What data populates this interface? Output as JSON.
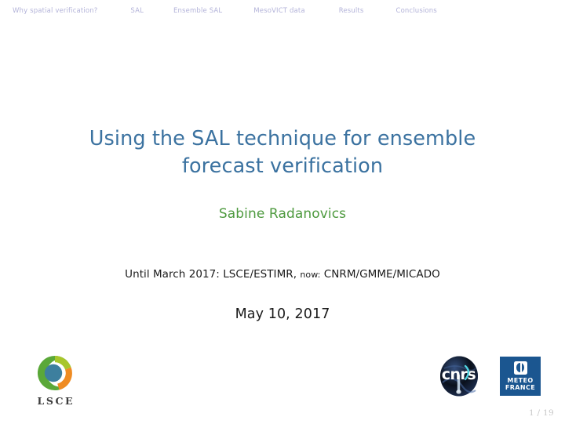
{
  "navigation": {
    "items": [
      {
        "label": "Why spatial verification?"
      },
      {
        "label": "SAL"
      },
      {
        "label": "Ensemble SAL"
      },
      {
        "label": "MesoVICT data"
      },
      {
        "label": "Results"
      },
      {
        "label": "Conclusions"
      }
    ],
    "color": "#b3b3d9"
  },
  "title": {
    "line1": "Using the SAL technique for ensemble forecast",
    "line2": "verification",
    "color": "#3b72a0"
  },
  "author": {
    "name": "Sabine Radanovics",
    "color": "#4e9a3f"
  },
  "institute": {
    "part1": "Until March 2017: LSCE/ESTIMR,",
    "part2": "now:",
    "part3": "CNRM/GMME/MICADO"
  },
  "date": {
    "text": "May 10, 2017"
  },
  "logos": {
    "lsce": {
      "text": "LSCE",
      "ring_green": "#5aa838",
      "arc_yellow_green": "#a8c62b",
      "arc_orange": "#ef8b22",
      "center_blue": "#3d7f9e",
      "text_color": "#3c3c3c"
    },
    "cnrs": {
      "text": "cnrs",
      "circle_color": "#253a63",
      "accent_color": "#3fbfd0"
    },
    "meteo_france": {
      "line1": "METEO",
      "line2": "FRANCE",
      "background": "#1b5690"
    }
  },
  "footer": {
    "page_indicator": "1 / 19"
  }
}
